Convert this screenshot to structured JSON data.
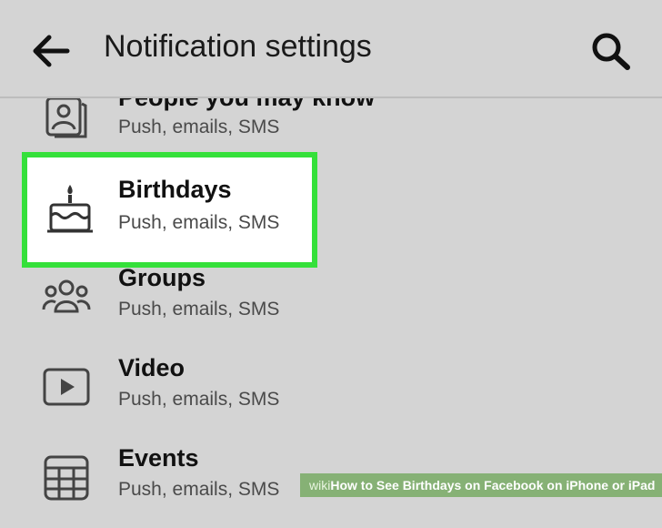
{
  "header": {
    "title": "Notification settings",
    "back_icon": "arrow-left-icon",
    "search_icon": "search-icon"
  },
  "items": [
    {
      "title": "People you may know",
      "subtitle": "Push, emails, SMS",
      "icon": "person-card-icon"
    },
    {
      "title": "Birthdays",
      "subtitle": "Push, emails, SMS",
      "icon": "birthday-cake-icon",
      "highlighted": true
    },
    {
      "title": "Groups",
      "subtitle": "Push, emails, SMS",
      "icon": "group-icon"
    },
    {
      "title": "Video",
      "subtitle": "Push, emails, SMS",
      "icon": "video-play-icon"
    },
    {
      "title": "Events",
      "subtitle": "Push, emails, SMS",
      "icon": "calendar-icon"
    }
  ],
  "colors": {
    "background": "#d4d4d4",
    "highlight_border": "#35e03a",
    "highlight_fill": "#ffffff"
  },
  "watermark": {
    "prefix": "wiki",
    "how": "How",
    "text": " to See Birthdays on Facebook on iPhone or iPad"
  }
}
